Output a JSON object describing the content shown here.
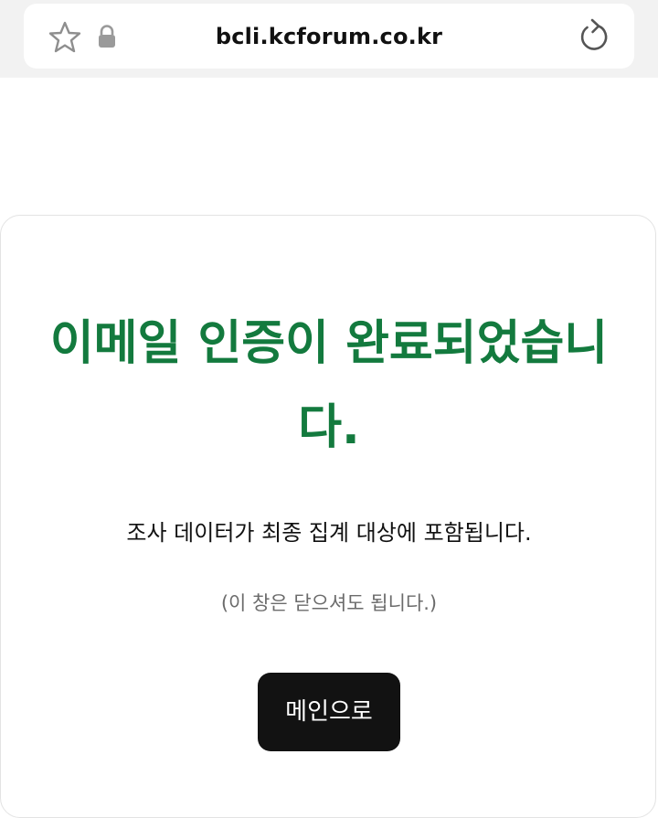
{
  "browser": {
    "url": "bcli.kcforum.co.kr",
    "icons": [
      "star-icon",
      "lock-icon",
      "reload-icon"
    ]
  },
  "page": {
    "heading": "이메일 인증이 완료되었습니다.",
    "description": "조사 데이터가 최종 집계 대상에 포함됩니다.",
    "note": "(이 창은 닫으셔도 됩니다.)",
    "main_button_label": "메인으로"
  },
  "colors": {
    "heading": "#137a3e",
    "button_bg": "#121212",
    "button_text": "#ffffff",
    "note": "#6b6b6b",
    "browser_bar": "#f2f2f2"
  }
}
